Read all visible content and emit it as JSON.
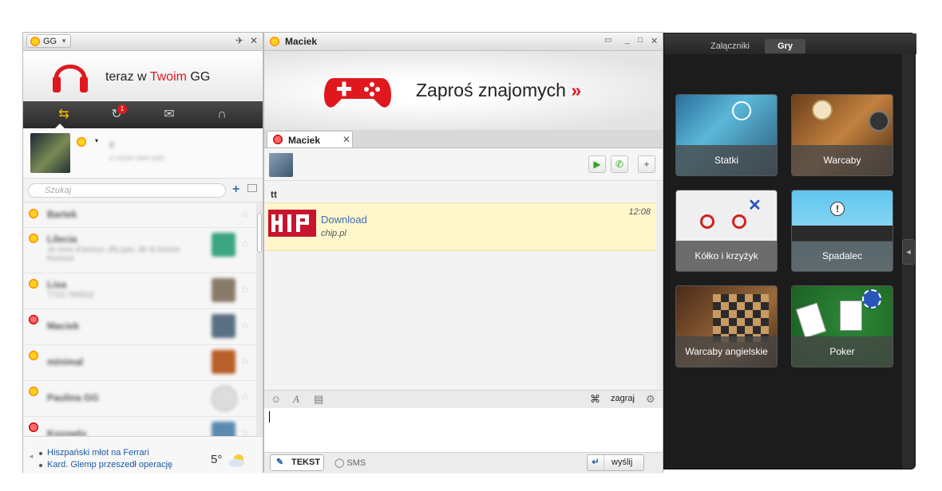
{
  "left": {
    "status_selector": "GG",
    "banner_prefix": "teraz w ",
    "banner_brand": "Twoim",
    "banner_suffix": " GG",
    "nav_badge": "1",
    "search_placeholder": "Szukaj",
    "news": [
      "Hiszpański młot na Ferrari",
      "Kard. Glemp przeszedł operację"
    ],
    "temperature": "5°"
  },
  "chat": {
    "title": "Maciek",
    "banner_text": "Zaproś znajomych",
    "banner_arrow": "»",
    "tab_label": "Maciek",
    "sender": "tt",
    "message": {
      "link": "Download",
      "source": "chip.pl",
      "time": "12:08"
    },
    "play_label": "zagraj",
    "mode_text": "TEKST",
    "mode_sms": "SMS",
    "send_label": "wyślij"
  },
  "games": {
    "tabs": [
      "Załączniki",
      "Gry"
    ],
    "active_tab": "Gry",
    "items": [
      {
        "label": "Statki"
      },
      {
        "label": "Warcaby"
      },
      {
        "label": "Kółko i krzyżyk"
      },
      {
        "label": "Spadalec"
      },
      {
        "label": "Warcaby angielskie"
      },
      {
        "label": "Poker"
      }
    ]
  },
  "colors": {
    "accent_red": "#e0181e",
    "link_blue": "#3b6eb5",
    "message_bg": "#fff6cc"
  }
}
